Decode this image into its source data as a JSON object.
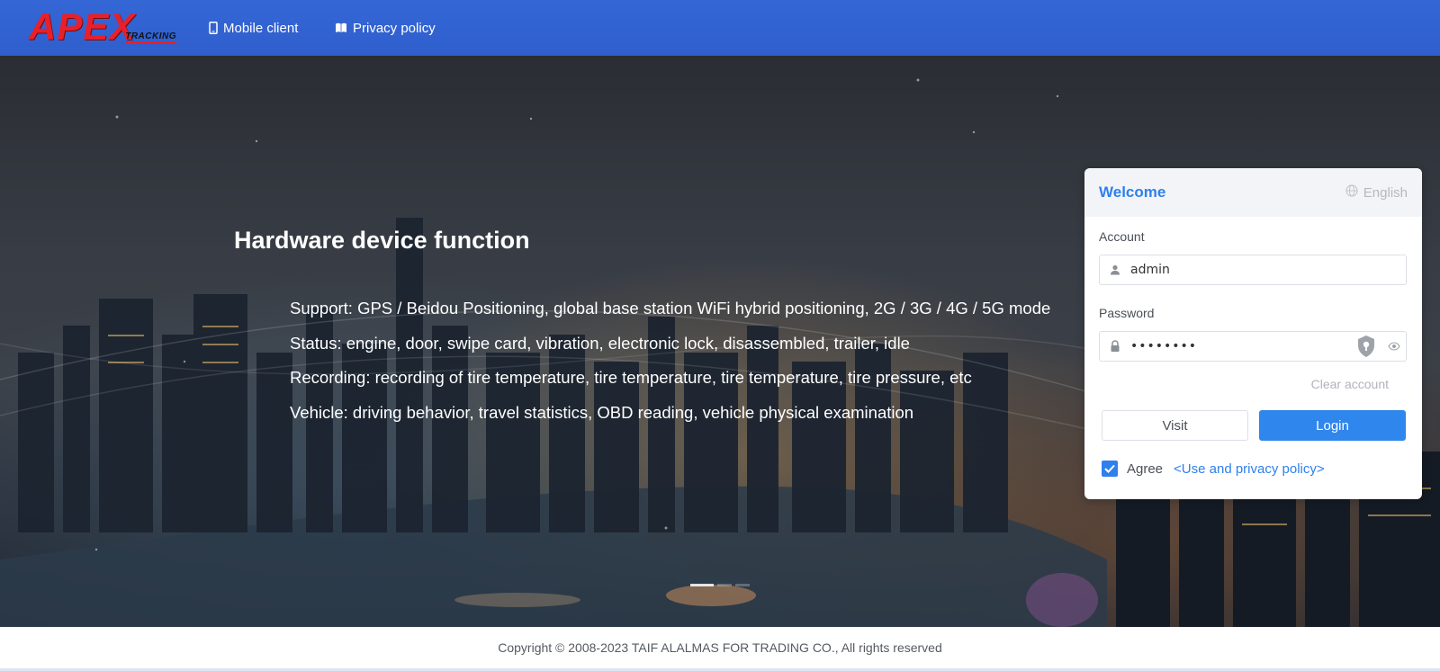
{
  "header": {
    "logo_text": "APEX",
    "logo_subtext": "TRACKING",
    "nav": [
      {
        "label": "Mobile client",
        "icon": "mobile-phone-icon"
      },
      {
        "label": "Privacy policy",
        "icon": "book-icon"
      }
    ]
  },
  "hero": {
    "title": "Hardware device function",
    "lines": [
      "Support: GPS / Beidou Positioning, global base station WiFi hybrid positioning, 2G / 3G / 4G / 5G mode",
      "Status: engine, door, swipe card, vibration, electronic lock, disassembled, trailer, idle",
      "Recording: recording of tire temperature, tire temperature, tire temperature, tire pressure, etc",
      "Vehicle: driving behavior, travel statistics, OBD reading, vehicle physical examination"
    ],
    "carousel": {
      "slides": 3,
      "active_index": 0
    }
  },
  "login": {
    "title": "Welcome",
    "language": "English",
    "account_label": "Account",
    "account_value": "admin",
    "password_label": "Password",
    "password_value": "••••••••",
    "clear_account": "Clear account",
    "visit_button": "Visit",
    "login_button": "Login",
    "agree_label": "Agree",
    "agree_checked": true,
    "policy_link": "<Use and privacy policy>"
  },
  "footer": {
    "copyright": "Copyright © 2008-2023 TAIF ALALMAS FOR TRADING CO., All rights reserved"
  },
  "colors": {
    "topbar": "#3566d6",
    "accent": "#2f80ed",
    "logo_red": "#e8202a"
  }
}
